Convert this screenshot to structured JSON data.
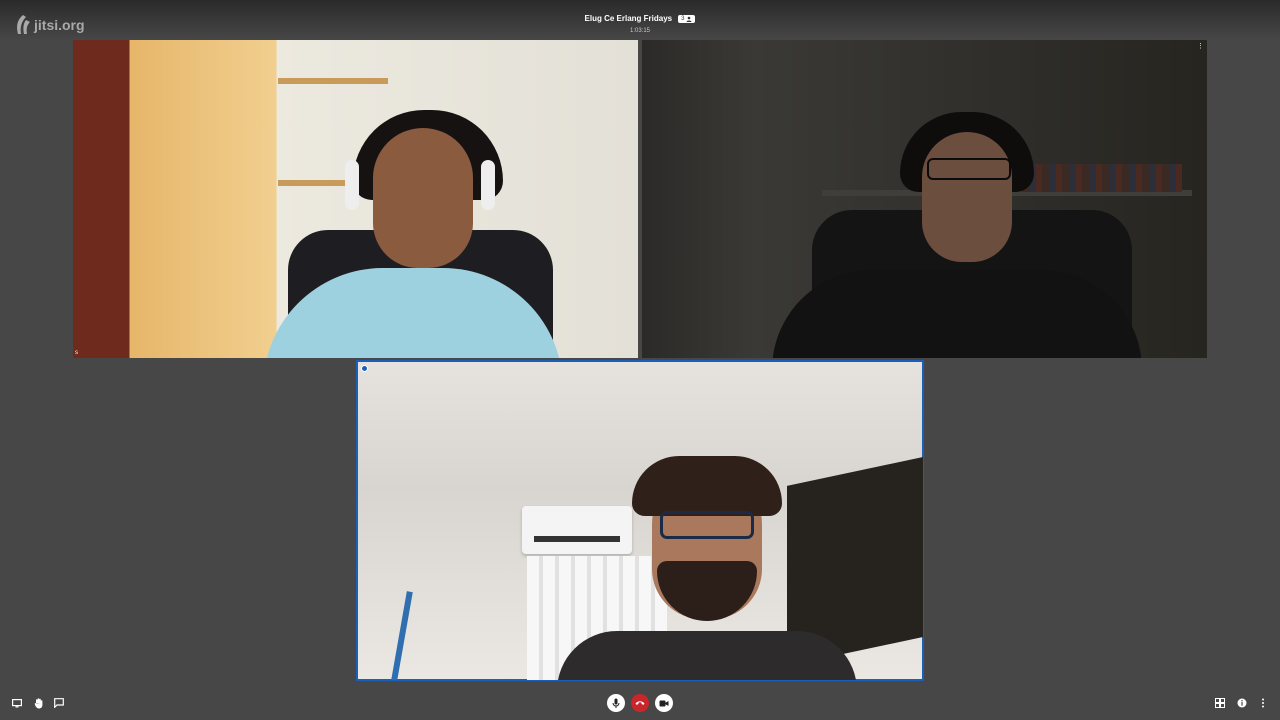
{
  "app": {
    "watermark": "jitsi.org"
  },
  "header": {
    "subject": "Elug Ce Erlang Fridays",
    "participant_count": "3",
    "timer": "1:03:15"
  },
  "tiles": [
    {
      "name": "participant-1",
      "menu": "⋮",
      "audio": "s"
    },
    {
      "name": "participant-2",
      "menu": "⋮"
    },
    {
      "name": "participant-3-active-speaker"
    }
  ],
  "toolbar": {
    "left": [
      "screen-share-icon",
      "raise-hand-icon",
      "chat-icon"
    ],
    "center": [
      "microphone-icon",
      "hangup-icon",
      "camera-icon"
    ],
    "right": [
      "tile-view-icon",
      "info-icon",
      "more-icon"
    ]
  },
  "colors": {
    "background": "#474747",
    "accent": "#1b5fbd",
    "hangup": "#c9262c"
  }
}
